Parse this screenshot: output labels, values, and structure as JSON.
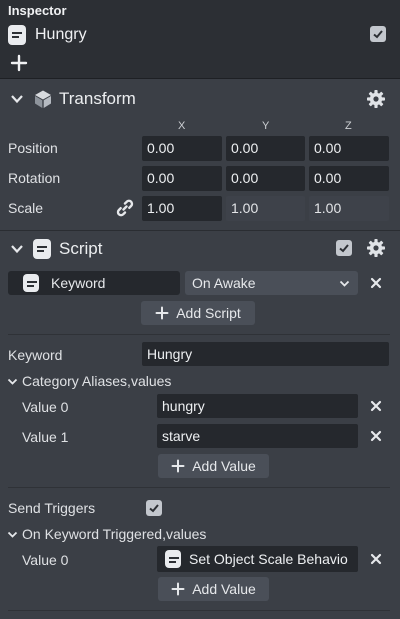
{
  "panel": {
    "title": "Inspector"
  },
  "object": {
    "name": "Hungry",
    "enabled": true
  },
  "transform": {
    "title": "Transform",
    "axes": [
      "X",
      "Y",
      "Z"
    ],
    "rows": [
      {
        "label": "Position",
        "values": [
          "0.00",
          "0.00",
          "0.00"
        ]
      },
      {
        "label": "Rotation",
        "values": [
          "0.00",
          "0.00",
          "0.00"
        ]
      },
      {
        "label": "Scale",
        "values": [
          "1.00",
          "1.00",
          "1.00"
        ]
      }
    ]
  },
  "script": {
    "title": "Script",
    "enabled": true,
    "asset": "Keyword",
    "event": "On Awake",
    "add_script_label": "Add Script",
    "keyword_label": "Keyword",
    "keyword_value": "Hungry",
    "aliases_label": "Category Aliases,values",
    "aliases": [
      {
        "label": "Value 0",
        "value": "hungry"
      },
      {
        "label": "Value 1",
        "value": "starve"
      }
    ],
    "add_value_label": "Add Value",
    "send_triggers_label": "Send Triggers",
    "send_triggers": true,
    "triggered_label": "On Keyword Triggered,values",
    "triggered": [
      {
        "label": "Value 0",
        "value": "Set Object Scale Behavio"
      }
    ],
    "add_value_label_2": "Add Value"
  },
  "icons": {
    "header_check": "checkbox-checked-icon",
    "add": "plus-icon",
    "transform": "cube-icon",
    "settings": "gear-icon",
    "link": "link-icon",
    "remove": "close-icon",
    "collapse": "chevron-down-icon"
  },
  "colors": {
    "background": "#3b3f46",
    "field": "#25282d",
    "button": "#4a4f58",
    "header": "#2c2f34"
  }
}
